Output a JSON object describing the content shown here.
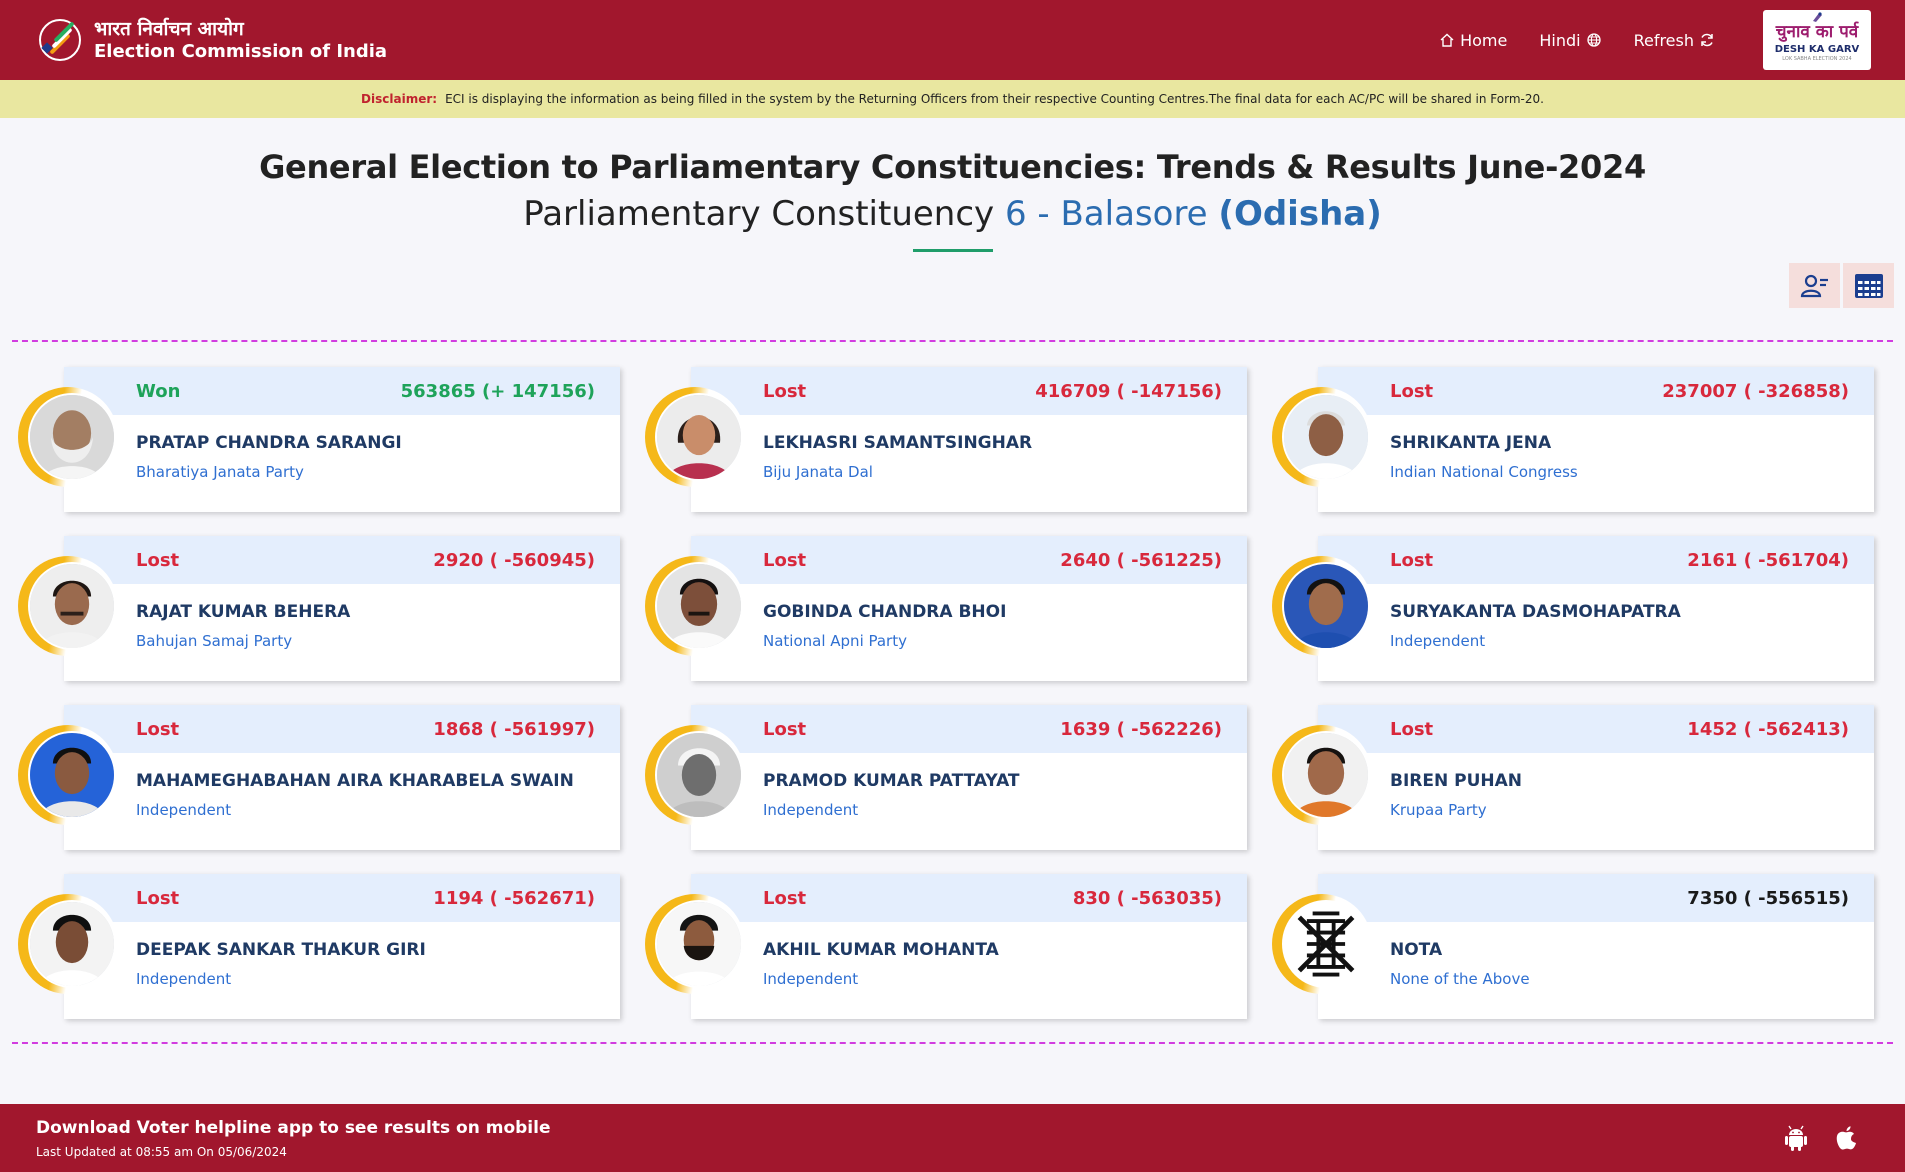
{
  "header": {
    "title_hindi": "भारत निर्वाचन आयोग",
    "title_english": "Election Commission of India",
    "nav": {
      "home": "Home",
      "hindi": "Hindi",
      "refresh": "Refresh"
    },
    "badge_hindi": "चुनाव का पर्व",
    "badge_english": "DESH KA GARV",
    "badge_sub": "LOK SABHA ELECTION 2024"
  },
  "disclaimer": {
    "label": "Disclaimer:",
    "text": "ECI is displaying the information as being filled in the system by the Returning Officers from their respective Counting Centres.The final data for each AC/PC will be shared in Form-20."
  },
  "title": {
    "line1": "General Election to Parliamentary Constituencies: Trends & Results June-2024",
    "line2_prefix": "Parliamentary Constituency",
    "constituency": "6 - Balasore",
    "state": "(Odisha)"
  },
  "candidates": [
    {
      "status": "Won",
      "votes": "563865 (+ 147156)",
      "name": "PRATAP CHANDRA SARANGI",
      "party": "Bharatiya Janata Party"
    },
    {
      "status": "Lost",
      "votes": "416709 ( -147156)",
      "name": "LEKHASRI SAMANTSINGHAR",
      "party": "Biju Janata Dal"
    },
    {
      "status": "Lost",
      "votes": "237007 ( -326858)",
      "name": "SHRIKANTA JENA",
      "party": "Indian National Congress"
    },
    {
      "status": "Lost",
      "votes": "2920 ( -560945)",
      "name": "RAJAT KUMAR BEHERA",
      "party": "Bahujan Samaj Party"
    },
    {
      "status": "Lost",
      "votes": "2640 ( -561225)",
      "name": "GOBINDA CHANDRA BHOI",
      "party": "National Apni Party"
    },
    {
      "status": "Lost",
      "votes": "2161 ( -561704)",
      "name": "SURYAKANTA DASMOHAPATRA",
      "party": "Independent"
    },
    {
      "status": "Lost",
      "votes": "1868 ( -561997)",
      "name": "MAHAMEGHABAHAN AIRA KHARABELA SWAIN",
      "party": "Independent"
    },
    {
      "status": "Lost",
      "votes": "1639 ( -562226)",
      "name": "PRAMOD KUMAR PATTAYAT",
      "party": "Independent"
    },
    {
      "status": "Lost",
      "votes": "1452 ( -562413)",
      "name": "BIREN PUHAN",
      "party": "Krupaa Party"
    },
    {
      "status": "Lost",
      "votes": "1194 ( -562671)",
      "name": "DEEPAK SANKAR THAKUR GIRI",
      "party": "Independent"
    },
    {
      "status": "Lost",
      "votes": "830 ( -563035)",
      "name": "AKHIL KUMAR MOHANTA",
      "party": "Independent"
    },
    {
      "status": "",
      "votes": "7350 ( -556515)",
      "name": "NOTA",
      "party": "None of the Above"
    }
  ],
  "footer": {
    "main": "Download Voter helpline app to see results on mobile",
    "sub": "Last Updated at 08:55 am On 05/06/2024"
  },
  "colors": {
    "brand": "#a1172d",
    "won": "#1ea35a",
    "lost": "#d8283c",
    "link": "#2f6fd1"
  }
}
